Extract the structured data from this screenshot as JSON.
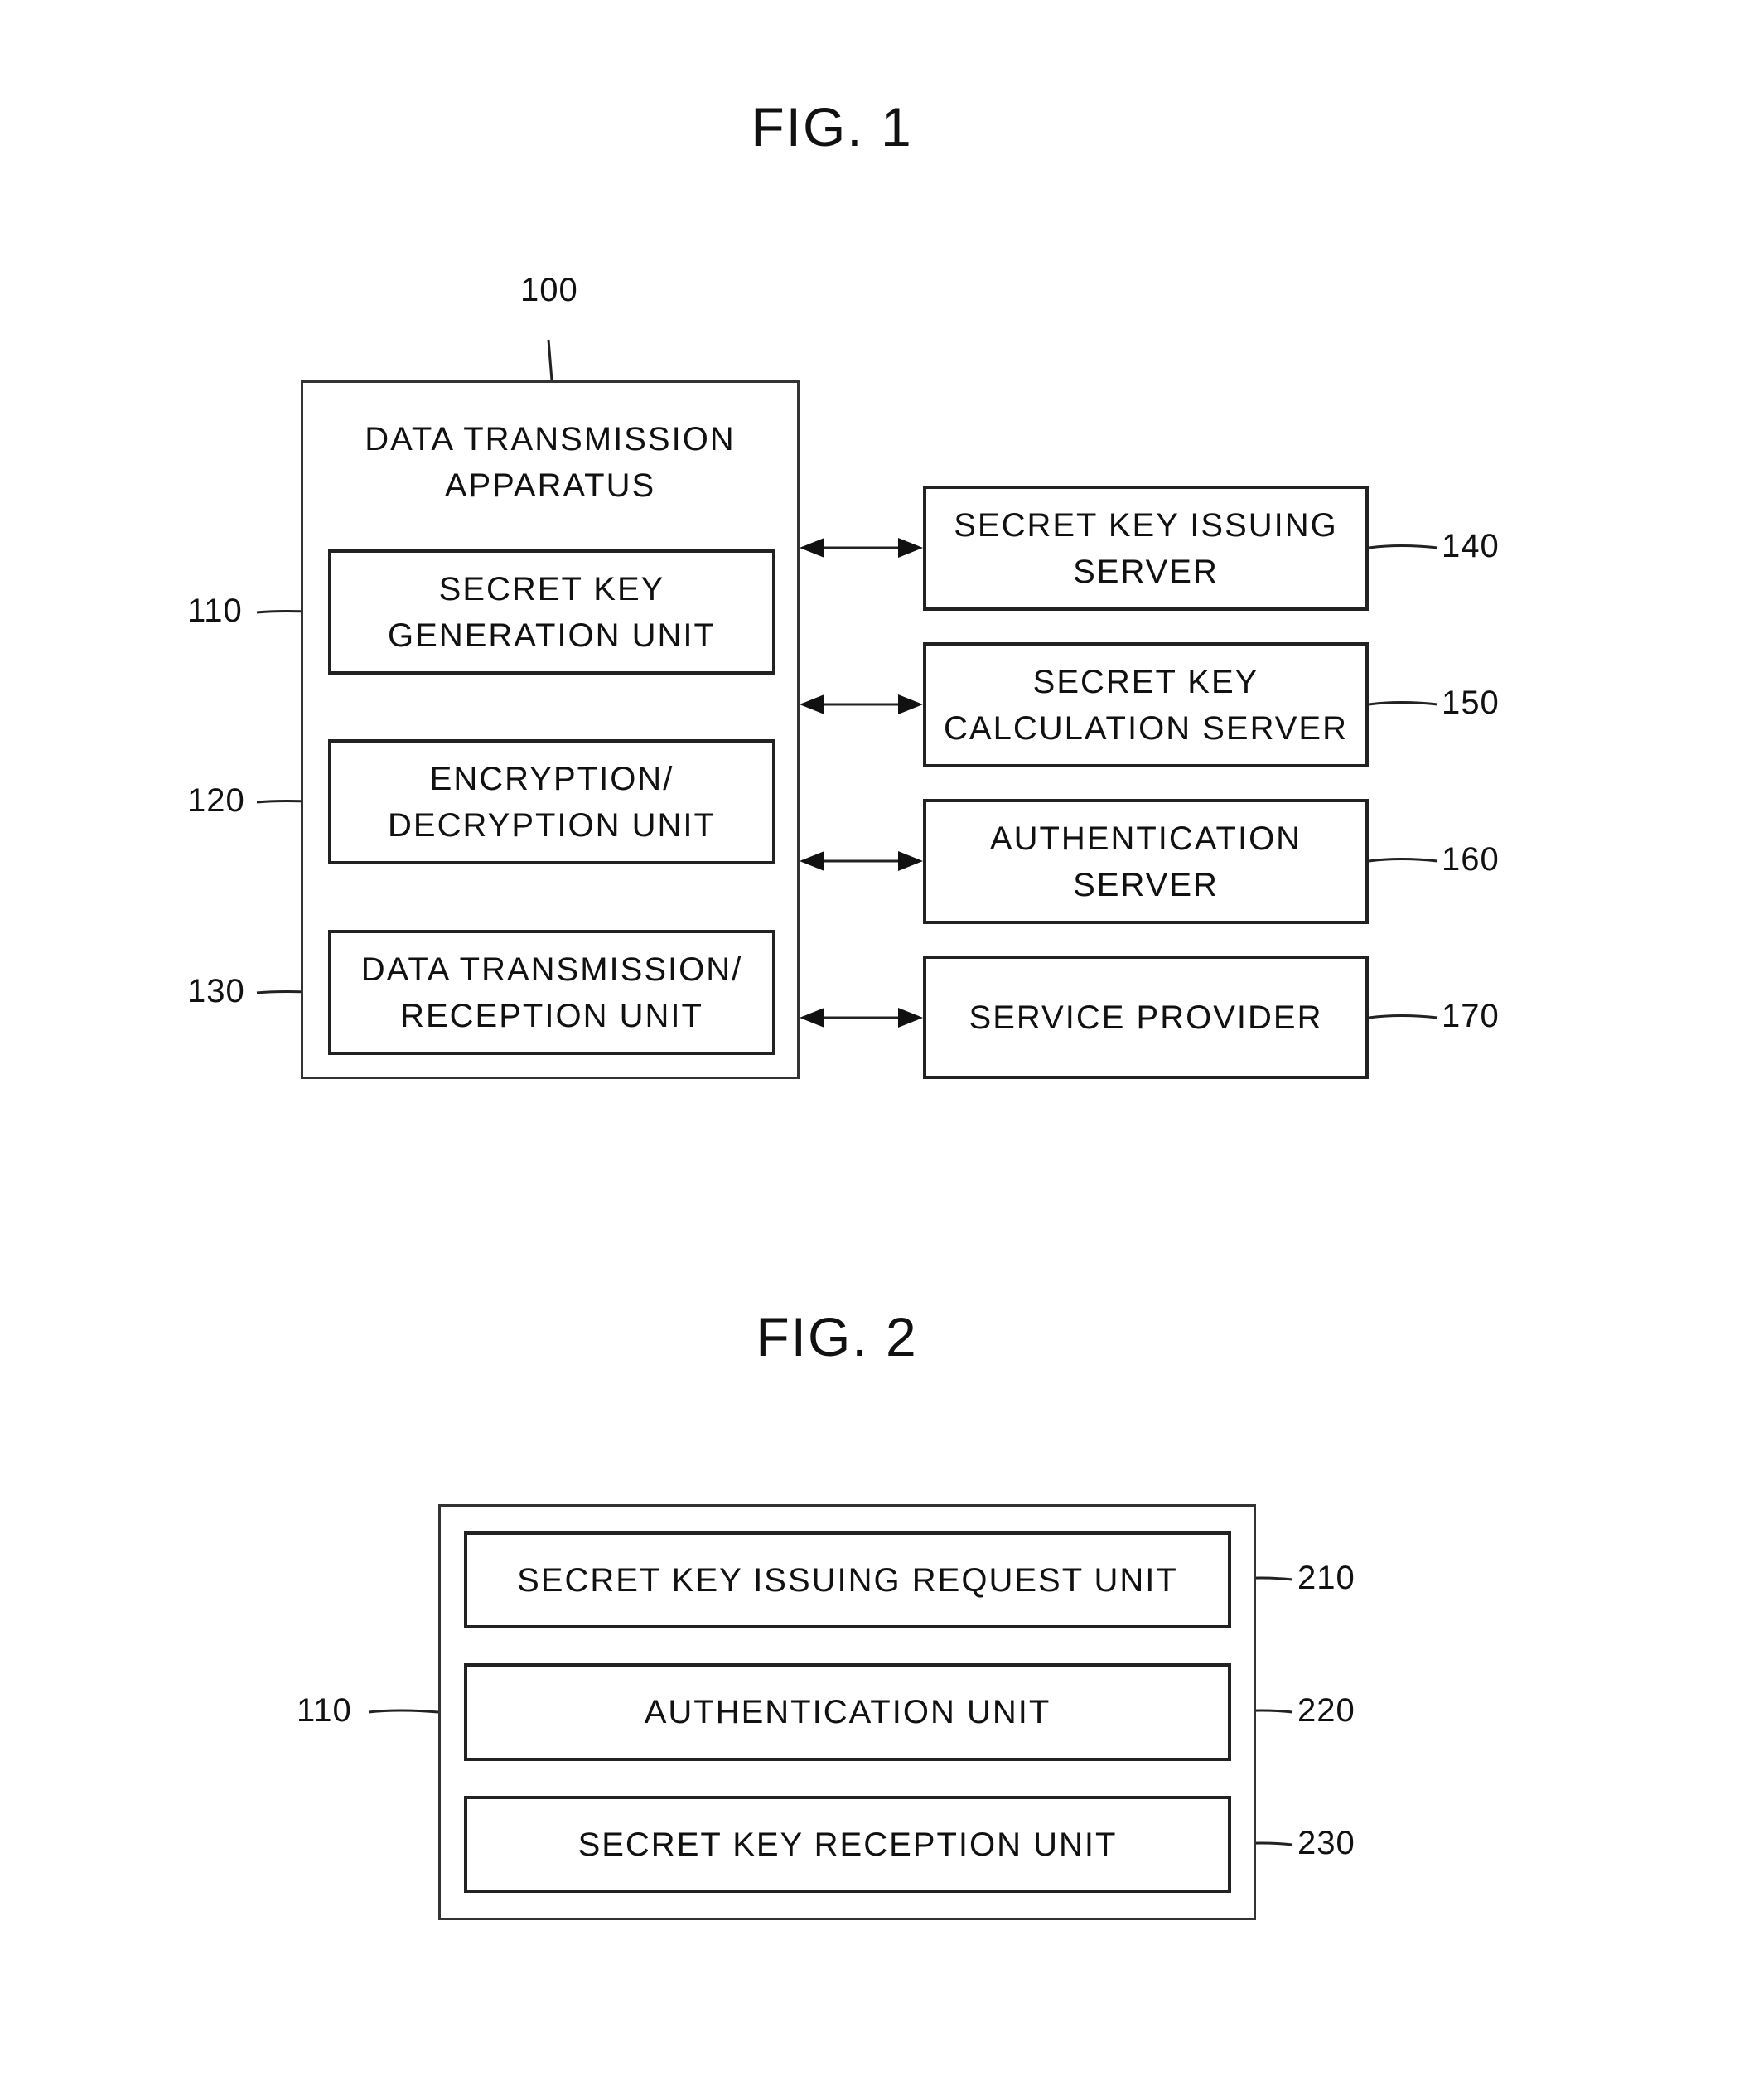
{
  "fig1": {
    "title": "FIG. 1",
    "apparatus": {
      "ref": "100",
      "label": "DATA TRANSMISSION\nAPPARATUS"
    },
    "units": [
      {
        "ref": "110",
        "label": "SECRET KEY\nGENERATION UNIT"
      },
      {
        "ref": "120",
        "label": "ENCRYPTION/\nDECRYPTION UNIT"
      },
      {
        "ref": "130",
        "label": "DATA TRANSMISSION/\nRECEPTION UNIT"
      }
    ],
    "servers": [
      {
        "ref": "140",
        "label": "SECRET KEY ISSUING\nSERVER"
      },
      {
        "ref": "150",
        "label": "SECRET KEY\nCALCULATION SERVER"
      },
      {
        "ref": "160",
        "label": "AUTHENTICATION\nSERVER"
      },
      {
        "ref": "170",
        "label": "SERVICE PROVIDER"
      }
    ]
  },
  "fig2": {
    "title": "FIG. 2",
    "container_ref": "110",
    "units": [
      {
        "ref": "210",
        "label": "SECRET KEY ISSUING REQUEST UNIT"
      },
      {
        "ref": "220",
        "label": "AUTHENTICATION UNIT"
      },
      {
        "ref": "230",
        "label": "SECRET KEY RECEPTION UNIT"
      }
    ]
  }
}
